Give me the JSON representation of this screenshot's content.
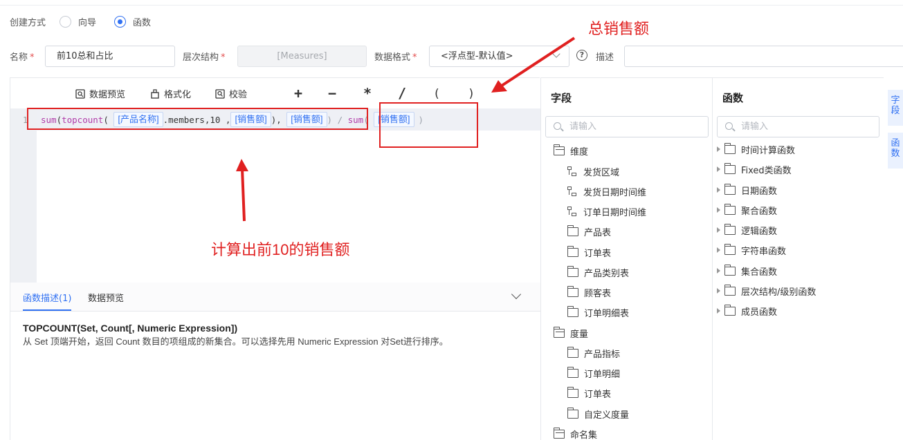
{
  "create_mode": {
    "label": "创建方式",
    "options": [
      {
        "label": "向导",
        "selected": false
      },
      {
        "label": "函数",
        "selected": true
      }
    ]
  },
  "form": {
    "name_label": "名称",
    "name_value": "前10总和占比",
    "hierarchy_label": "层次结构",
    "hierarchy_value": "[Measures]",
    "format_label": "数据格式",
    "format_value": "<浮点型-默认值>",
    "help_glyph": "?",
    "desc_label": "描述",
    "desc_value": "",
    "required_mark": "*"
  },
  "toolbar": {
    "preview": "数据预览",
    "format": "格式化",
    "validate": "校验",
    "operators": [
      "+",
      "−",
      "*",
      "/",
      "(",
      ")"
    ]
  },
  "editor": {
    "line_number": "1",
    "code": {
      "sum1": "sum",
      "p1": "(",
      "topcount": "topcount",
      "p2": "( ",
      "tok1": "[产品名称]",
      "members": ".members,10 ,",
      "tok2": "[销售额]",
      "close1": "), ",
      "tok3": "[销售额]",
      "close2": ") / ",
      "sum2": "sum",
      "p3": "( ",
      "tok4": "[销售额]",
      "close3": ")"
    }
  },
  "annotations": {
    "total": "总销售额",
    "top10": "计算出前10的销售额"
  },
  "desc_tabs": [
    {
      "label": "函数描述(1)",
      "active": true
    },
    {
      "label": "数据预览",
      "active": false
    }
  ],
  "description": {
    "title": "TOPCOUNT(Set, Count[, Numeric Expression])",
    "text": "从 Set 顶端开始，返回 Count 数目的项组成的新集合。可以选择先用 Numeric Expression 对Set进行排序。"
  },
  "fields": {
    "title": "字段",
    "search_placeholder": "请输入",
    "groups": [
      {
        "label": "维度",
        "items": [
          {
            "label": "发货区域",
            "icon": "hierarchy-icon"
          },
          {
            "label": "发货日期时间维",
            "icon": "hierarchy-icon"
          },
          {
            "label": "订单日期时间维",
            "icon": "hierarchy-icon"
          },
          {
            "label": "产品表",
            "icon": "folder-icon"
          },
          {
            "label": "订单表",
            "icon": "folder-icon"
          },
          {
            "label": "产品类别表",
            "icon": "folder-icon"
          },
          {
            "label": "顾客表",
            "icon": "folder-icon"
          },
          {
            "label": "订单明细表",
            "icon": "folder-icon"
          }
        ]
      },
      {
        "label": "度量",
        "items": [
          {
            "label": "产品指标",
            "icon": "folder-icon"
          },
          {
            "label": "订单明细",
            "icon": "folder-icon"
          },
          {
            "label": "订单表",
            "icon": "folder-icon"
          },
          {
            "label": "自定义度量",
            "icon": "folder-icon"
          }
        ]
      },
      {
        "label": "命名集",
        "items": []
      }
    ]
  },
  "functions": {
    "title": "函数",
    "search_placeholder": "请输入",
    "items": [
      "时间计算函数",
      "Fixed类函数",
      "日期函数",
      "聚合函数",
      "逻辑函数",
      "字符串函数",
      "集合函数",
      "层次结构/级别函数",
      "成员函数"
    ]
  },
  "side_tabs": [
    "字段",
    "函数"
  ],
  "colors": {
    "accent": "#3171f2",
    "annotation": "#e02020",
    "token_bg": "#f4f8ff"
  }
}
